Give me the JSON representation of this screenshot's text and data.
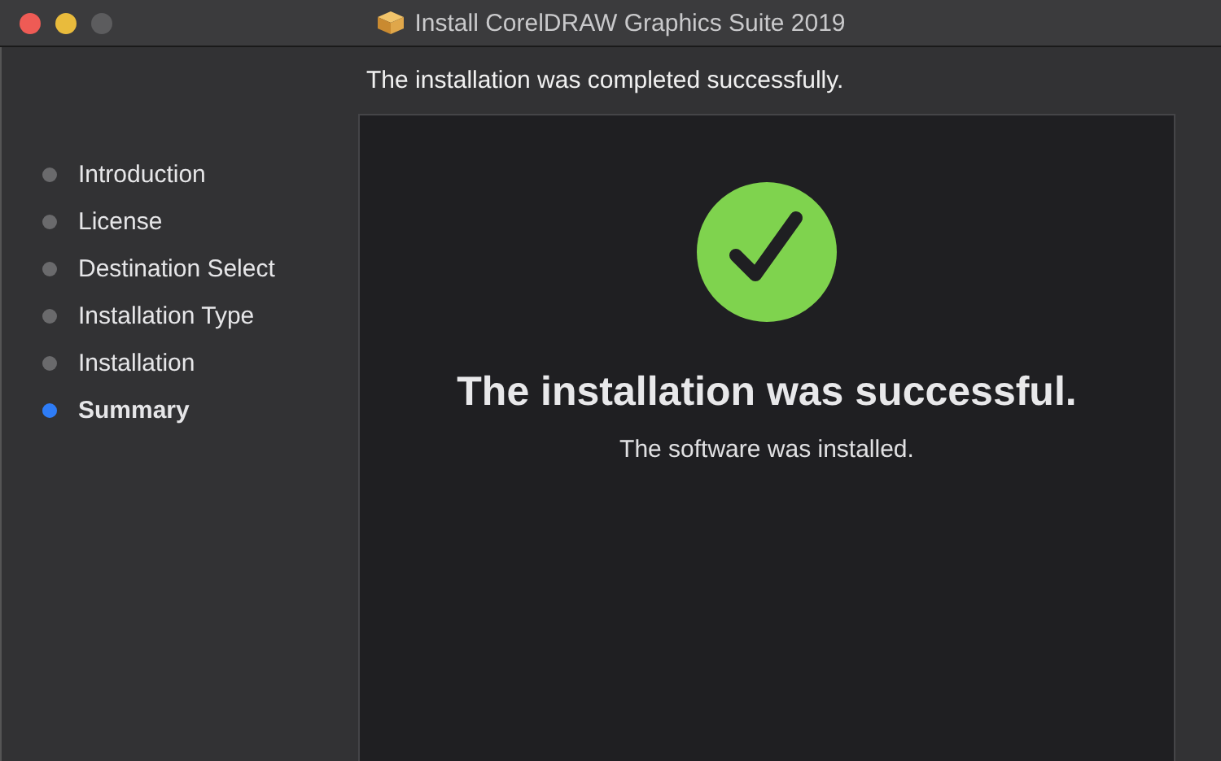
{
  "window": {
    "title": "Install CorelDRAW Graphics Suite 2019"
  },
  "steps": [
    {
      "label": "Introduction",
      "selected": false
    },
    {
      "label": "License",
      "selected": false
    },
    {
      "label": "Destination Select",
      "selected": false
    },
    {
      "label": "Installation Type",
      "selected": false
    },
    {
      "label": "Installation",
      "selected": false
    },
    {
      "label": "Summary",
      "selected": true
    }
  ],
  "header": "The installation was completed successfully.",
  "result": {
    "title": "The installation was successful.",
    "message": "The software was installed."
  }
}
